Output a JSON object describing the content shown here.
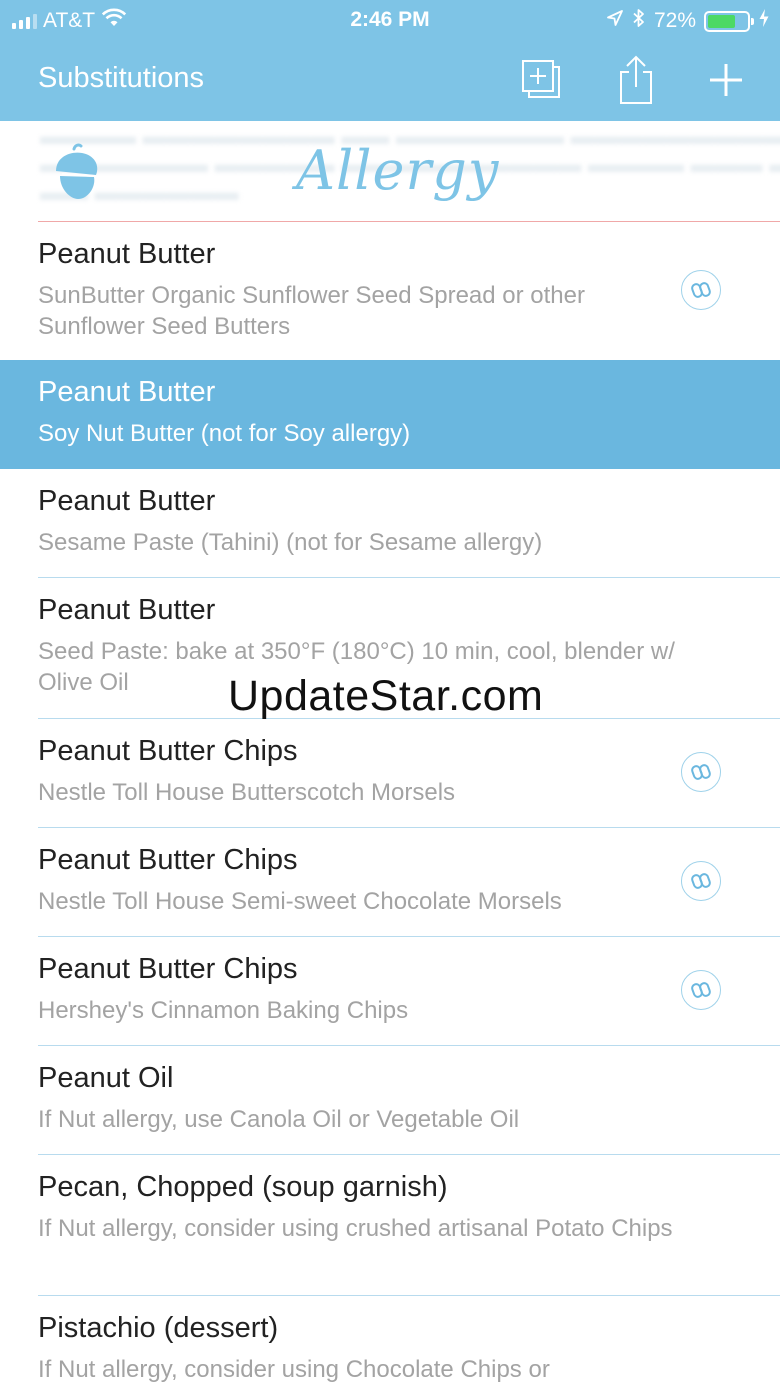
{
  "status_bar": {
    "carrier": "AT&T",
    "time": "2:46 PM",
    "battery_percent": "72%",
    "battery_level": 0.72,
    "icons": [
      "signal-icon",
      "wifi-icon",
      "location-icon",
      "bluetooth-icon",
      "battery-icon",
      "charging-icon"
    ]
  },
  "nav": {
    "title": "Substitutions",
    "buttons": [
      "duplicate-icon",
      "share-icon",
      "add-icon"
    ]
  },
  "banner": {
    "title": "Allergy",
    "icon": "acorn-icon"
  },
  "colors": {
    "accent": "#7ec4e6",
    "selected_row": "#6ab7df",
    "battery_green": "#4cd964",
    "subtitle_gray": "#a3a3a3"
  },
  "rows": [
    {
      "title": "Peanut Butter",
      "subtitle": "SunButter Organic Sunflower Seed Spread or other Sunflower Seed Butters",
      "has_link": true,
      "selected": false
    },
    {
      "title": "Peanut Butter",
      "subtitle": "Soy Nut Butter (not for Soy allergy)",
      "has_link": false,
      "selected": true
    },
    {
      "title": "Peanut Butter",
      "subtitle": "Sesame Paste (Tahini) (not for Sesame allergy)",
      "has_link": false,
      "selected": false
    },
    {
      "title": "Peanut Butter",
      "subtitle": "Seed Paste: bake at 350°F (180°C) 10 min, cool, blender w/ Olive Oil",
      "has_link": false,
      "selected": false
    },
    {
      "title": "Peanut Butter Chips",
      "subtitle": "Nestle Toll House Butterscotch Morsels",
      "has_link": true,
      "selected": false
    },
    {
      "title": "Peanut Butter Chips",
      "subtitle": "Nestle Toll House Semi-sweet Chocolate Morsels",
      "has_link": true,
      "selected": false
    },
    {
      "title": "Peanut Butter Chips",
      "subtitle": "Hershey's Cinnamon Baking Chips",
      "has_link": true,
      "selected": false
    },
    {
      "title": "Peanut Oil",
      "subtitle": "If Nut allergy, use Canola Oil or Vegetable Oil",
      "has_link": false,
      "selected": false
    },
    {
      "title": "Pecan, Chopped (soup garnish)",
      "subtitle": "If Nut allergy, consider using crushed artisanal Potato Chips",
      "has_link": false,
      "selected": false
    },
    {
      "title": "Pistachio (dessert)",
      "subtitle": "If Nut allergy, consider using Chocolate Chips or",
      "has_link": false,
      "selected": false
    }
  ],
  "watermark": "UpdateStar.com"
}
